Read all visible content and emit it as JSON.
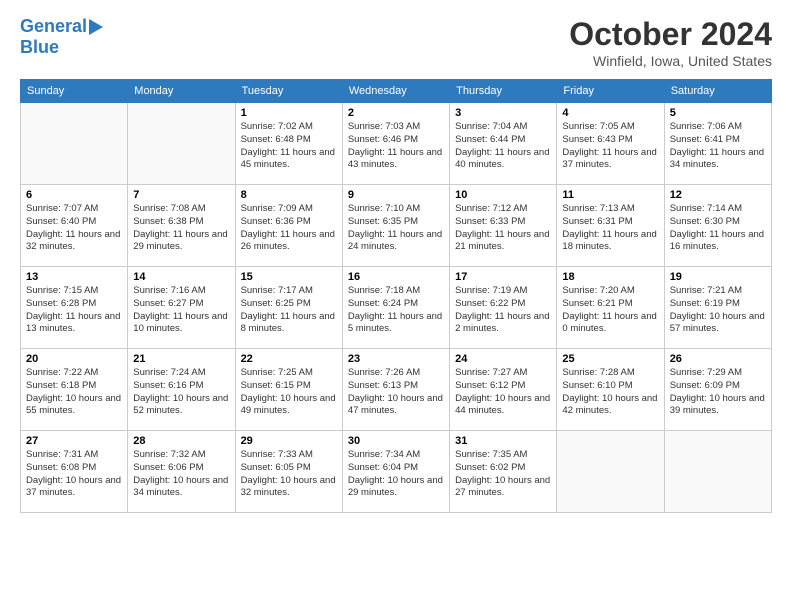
{
  "header": {
    "logo_line1": "General",
    "logo_line2": "Blue",
    "month_title": "October 2024",
    "location": "Winfield, Iowa, United States"
  },
  "days_of_week": [
    "Sunday",
    "Monday",
    "Tuesday",
    "Wednesday",
    "Thursday",
    "Friday",
    "Saturday"
  ],
  "weeks": [
    [
      {
        "day": "",
        "info": ""
      },
      {
        "day": "",
        "info": ""
      },
      {
        "day": "1",
        "info": "Sunrise: 7:02 AM\nSunset: 6:48 PM\nDaylight: 11 hours and 45 minutes."
      },
      {
        "day": "2",
        "info": "Sunrise: 7:03 AM\nSunset: 6:46 PM\nDaylight: 11 hours and 43 minutes."
      },
      {
        "day": "3",
        "info": "Sunrise: 7:04 AM\nSunset: 6:44 PM\nDaylight: 11 hours and 40 minutes."
      },
      {
        "day": "4",
        "info": "Sunrise: 7:05 AM\nSunset: 6:43 PM\nDaylight: 11 hours and 37 minutes."
      },
      {
        "day": "5",
        "info": "Sunrise: 7:06 AM\nSunset: 6:41 PM\nDaylight: 11 hours and 34 minutes."
      }
    ],
    [
      {
        "day": "6",
        "info": "Sunrise: 7:07 AM\nSunset: 6:40 PM\nDaylight: 11 hours and 32 minutes."
      },
      {
        "day": "7",
        "info": "Sunrise: 7:08 AM\nSunset: 6:38 PM\nDaylight: 11 hours and 29 minutes."
      },
      {
        "day": "8",
        "info": "Sunrise: 7:09 AM\nSunset: 6:36 PM\nDaylight: 11 hours and 26 minutes."
      },
      {
        "day": "9",
        "info": "Sunrise: 7:10 AM\nSunset: 6:35 PM\nDaylight: 11 hours and 24 minutes."
      },
      {
        "day": "10",
        "info": "Sunrise: 7:12 AM\nSunset: 6:33 PM\nDaylight: 11 hours and 21 minutes."
      },
      {
        "day": "11",
        "info": "Sunrise: 7:13 AM\nSunset: 6:31 PM\nDaylight: 11 hours and 18 minutes."
      },
      {
        "day": "12",
        "info": "Sunrise: 7:14 AM\nSunset: 6:30 PM\nDaylight: 11 hours and 16 minutes."
      }
    ],
    [
      {
        "day": "13",
        "info": "Sunrise: 7:15 AM\nSunset: 6:28 PM\nDaylight: 11 hours and 13 minutes."
      },
      {
        "day": "14",
        "info": "Sunrise: 7:16 AM\nSunset: 6:27 PM\nDaylight: 11 hours and 10 minutes."
      },
      {
        "day": "15",
        "info": "Sunrise: 7:17 AM\nSunset: 6:25 PM\nDaylight: 11 hours and 8 minutes."
      },
      {
        "day": "16",
        "info": "Sunrise: 7:18 AM\nSunset: 6:24 PM\nDaylight: 11 hours and 5 minutes."
      },
      {
        "day": "17",
        "info": "Sunrise: 7:19 AM\nSunset: 6:22 PM\nDaylight: 11 hours and 2 minutes."
      },
      {
        "day": "18",
        "info": "Sunrise: 7:20 AM\nSunset: 6:21 PM\nDaylight: 11 hours and 0 minutes."
      },
      {
        "day": "19",
        "info": "Sunrise: 7:21 AM\nSunset: 6:19 PM\nDaylight: 10 hours and 57 minutes."
      }
    ],
    [
      {
        "day": "20",
        "info": "Sunrise: 7:22 AM\nSunset: 6:18 PM\nDaylight: 10 hours and 55 minutes."
      },
      {
        "day": "21",
        "info": "Sunrise: 7:24 AM\nSunset: 6:16 PM\nDaylight: 10 hours and 52 minutes."
      },
      {
        "day": "22",
        "info": "Sunrise: 7:25 AM\nSunset: 6:15 PM\nDaylight: 10 hours and 49 minutes."
      },
      {
        "day": "23",
        "info": "Sunrise: 7:26 AM\nSunset: 6:13 PM\nDaylight: 10 hours and 47 minutes."
      },
      {
        "day": "24",
        "info": "Sunrise: 7:27 AM\nSunset: 6:12 PM\nDaylight: 10 hours and 44 minutes."
      },
      {
        "day": "25",
        "info": "Sunrise: 7:28 AM\nSunset: 6:10 PM\nDaylight: 10 hours and 42 minutes."
      },
      {
        "day": "26",
        "info": "Sunrise: 7:29 AM\nSunset: 6:09 PM\nDaylight: 10 hours and 39 minutes."
      }
    ],
    [
      {
        "day": "27",
        "info": "Sunrise: 7:31 AM\nSunset: 6:08 PM\nDaylight: 10 hours and 37 minutes."
      },
      {
        "day": "28",
        "info": "Sunrise: 7:32 AM\nSunset: 6:06 PM\nDaylight: 10 hours and 34 minutes."
      },
      {
        "day": "29",
        "info": "Sunrise: 7:33 AM\nSunset: 6:05 PM\nDaylight: 10 hours and 32 minutes."
      },
      {
        "day": "30",
        "info": "Sunrise: 7:34 AM\nSunset: 6:04 PM\nDaylight: 10 hours and 29 minutes."
      },
      {
        "day": "31",
        "info": "Sunrise: 7:35 AM\nSunset: 6:02 PM\nDaylight: 10 hours and 27 minutes."
      },
      {
        "day": "",
        "info": ""
      },
      {
        "day": "",
        "info": ""
      }
    ]
  ]
}
